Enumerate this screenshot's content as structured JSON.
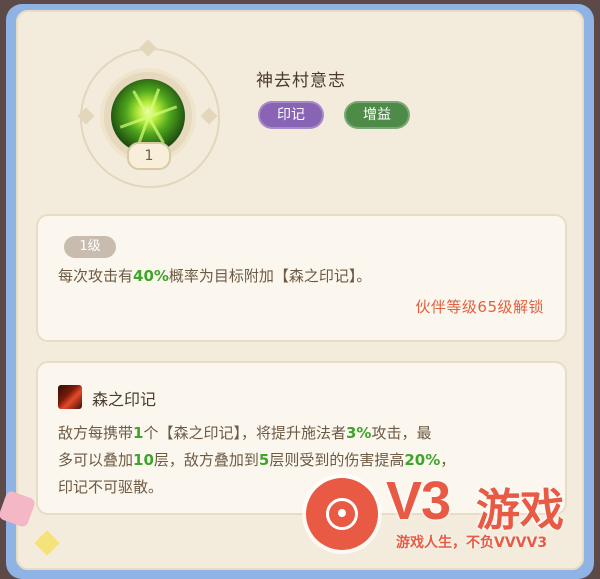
{
  "skill": {
    "name": "神去村意志",
    "level_badge": "1",
    "icon": "green-burst-skill-icon",
    "tags": [
      "印记",
      "增益"
    ]
  },
  "level_panel": {
    "level_label": "1级",
    "desc_pre": "每次攻击有",
    "desc_value": "40%",
    "desc_post": "概率为目标附加【森之印记】。",
    "unlock_text": "伙伴等级65级解锁"
  },
  "buff_panel": {
    "icon": "forest-mark-icon",
    "title": "森之印记",
    "line_a1": "敌方每携带",
    "line_a1_val": "1",
    "line_a2": "个【森之印记】，将提升施法者",
    "line_a2_val": "3%",
    "line_a3": "攻击，最",
    "line_b1": "多可以叠加",
    "line_b1_val": "10",
    "line_b2": "层，敌方叠加到",
    "line_b2_val": "5",
    "line_b3": "层则受到的伤害提高",
    "line_b3_val": "20%",
    "line_b4": "，",
    "line_c": "印记不可驱散。"
  },
  "watermark": {
    "brand": "V3",
    "brand_cn": "游戏",
    "slogan": "游戏人生，不负VVVV3"
  },
  "colors": {
    "tag_purple": "#8a64b4",
    "tag_green": "#4f8b48",
    "highlight": "#3fa52a",
    "unlock": "#e2603f"
  }
}
